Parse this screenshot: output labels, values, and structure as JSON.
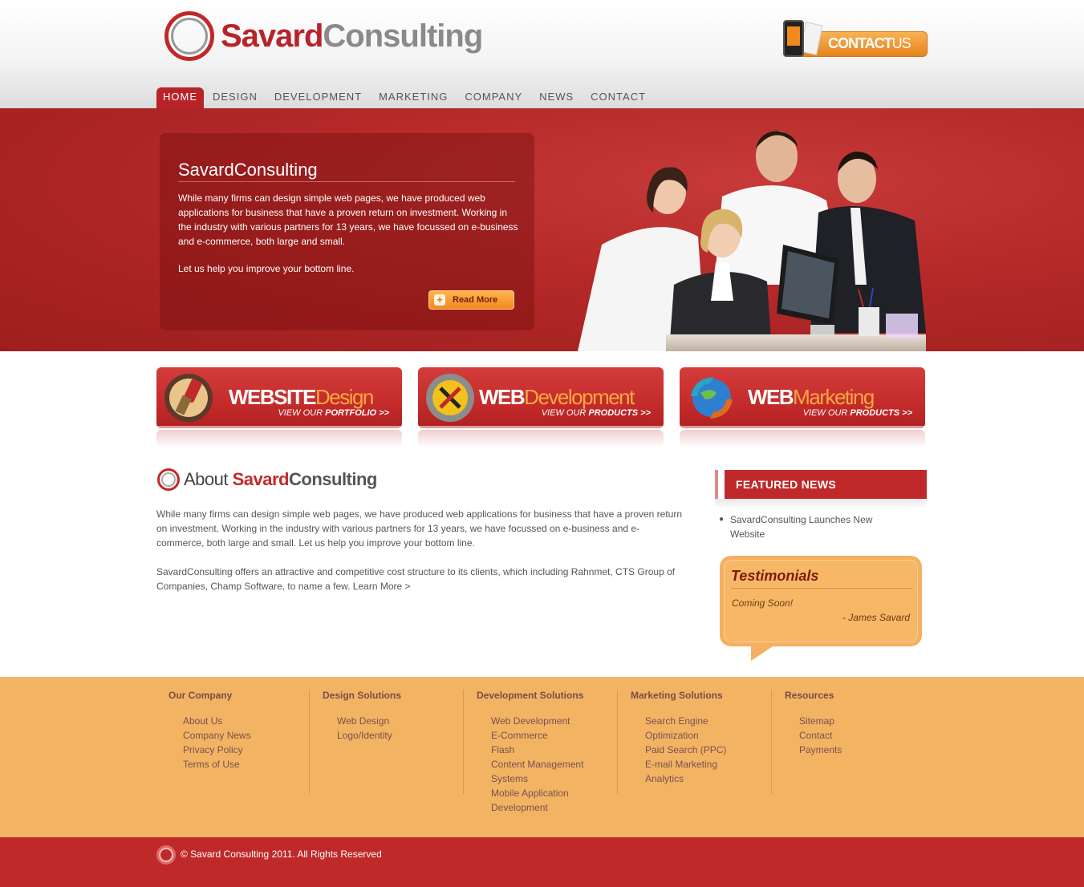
{
  "brand": {
    "part1": "Savard",
    "part2": "Consulting"
  },
  "contact_button": {
    "part1": "CONTACT",
    "part2": "US"
  },
  "nav": {
    "items": [
      {
        "label": "HOME"
      },
      {
        "label": "DESIGN"
      },
      {
        "label": "DEVELOPMENT"
      },
      {
        "label": "MARKETING"
      },
      {
        "label": "COMPANY"
      },
      {
        "label": "NEWS"
      },
      {
        "label": "CONTACT"
      }
    ]
  },
  "hero": {
    "title": "SavardConsulting",
    "paragraph": "While many firms can design simple web pages, we have produced web applications for business that have a proven return on investment. Working in the industry with various partners for 13 years, we have focussed on e-business and e-commerce, both large and small.",
    "tagline": "Let us help you improve your bottom line.",
    "read_more": "Read More",
    "plus": "+"
  },
  "services": [
    {
      "bold": "WEBSITE",
      "light": "Design",
      "sub_prefix": "VIEW OUR ",
      "sub_bold": "PORTFOLIO >>"
    },
    {
      "bold": "WEB",
      "light": "Development",
      "sub_prefix": "VIEW OUR ",
      "sub_bold": "PRODUCTS >>"
    },
    {
      "bold": "WEB",
      "light": "Marketing",
      "sub_prefix": "VIEW OUR ",
      "sub_bold": "PRODUCTS >>"
    }
  ],
  "about": {
    "title_prefix": "About ",
    "title_red": "Savard",
    "title_grey": "Consulting",
    "p1": "While many firms can design simple web pages, we have produced web applications for business that have a proven return on investment. Working in the industry with various partners for 13 years, we have focussed on e-business and e-commerce, both large and small. Let us help you improve your bottom line.",
    "p2_text": "SavardConsulting offers an attractive and competitive cost structure to its clients, which including Rahnmet, CTS Group of Companies, Champ Software, to name a few. ",
    "p2_link": "Learn More >"
  },
  "featured_news": {
    "title": "FEATURED NEWS",
    "items": [
      {
        "text": "SavardConsulting Launches New Website"
      }
    ]
  },
  "testimonials": {
    "title": "Testimonials",
    "quote": "Coming Soon!",
    "author": "- James Savard"
  },
  "footer": {
    "columns": [
      {
        "title": "Our Company",
        "links": [
          "About Us",
          "Company News",
          "Privacy Policy",
          "Terms of Use"
        ]
      },
      {
        "title": "Design Solutions",
        "links": [
          "Web Design",
          "Logo/Identity"
        ]
      },
      {
        "title": "Development Solutions",
        "links": [
          "Web Development",
          "E-Commerce",
          "Flash",
          "Content Management Systems",
          "Mobile Application Development"
        ]
      },
      {
        "title": "Marketing Solutions",
        "links": [
          "Search Engine Optimization",
          "Paid Search (PPC)",
          "E-mail Marketing",
          "Analytics"
        ]
      },
      {
        "title": "Resources",
        "links": [
          "Sitemap",
          "Contact",
          "Payments"
        ]
      }
    ],
    "copyright": "© Savard Consulting 2011. All Rights Reserved"
  },
  "colors": {
    "brand_red": "#c0292a",
    "accent_orange": "#f2b463",
    "nav_active": "#b8232a"
  },
  "icons": {
    "logo": "ring-logo-icon",
    "services": [
      "paintbrush-icon",
      "tools-gear-icon",
      "globe-arrows-icon"
    ]
  }
}
